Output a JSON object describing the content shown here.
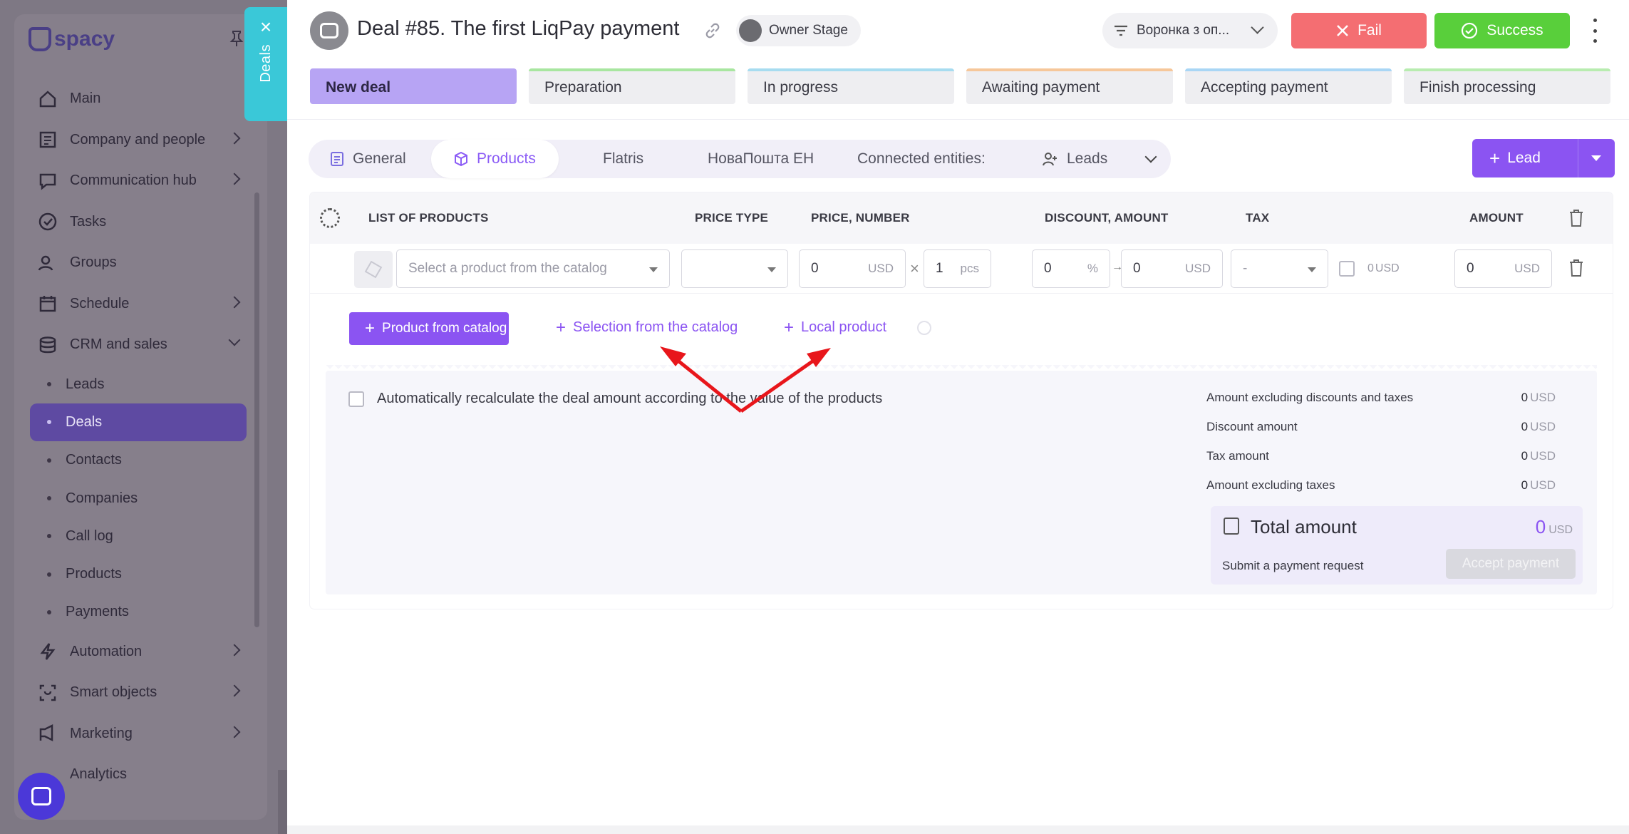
{
  "sidebar": {
    "logo": "spacy",
    "items": [
      {
        "label": "Main",
        "icon": "home-icon",
        "expand": false
      },
      {
        "label": "Company and people",
        "icon": "building-icon",
        "expand": true
      },
      {
        "label": "Communication hub",
        "icon": "chat-icon",
        "expand": true
      },
      {
        "label": "Tasks",
        "icon": "check-circle-icon",
        "expand": false
      },
      {
        "label": "Groups",
        "icon": "users-icon",
        "expand": false
      },
      {
        "label": "Schedule",
        "icon": "calendar-icon",
        "expand": true
      },
      {
        "label": "CRM and sales",
        "icon": "database-icon",
        "expand": true
      }
    ],
    "crm_sub": [
      "Leads",
      "Deals",
      "Contacts",
      "Companies",
      "Call log",
      "Products",
      "Payments"
    ],
    "items_after": [
      {
        "label": "Automation",
        "icon": "lightning-icon"
      },
      {
        "label": "Smart objects",
        "icon": "scan-icon"
      },
      {
        "label": "Marketing",
        "icon": "marketing-icon"
      },
      {
        "label": "Analytics",
        "icon": "analytics-icon"
      }
    ],
    "deals_tab": "Deals"
  },
  "header": {
    "title": "Deal #85. The first LiqPay payment",
    "stage_chip": "Owner Stage",
    "funnel": "Воронка з оп...",
    "fail_label": "Fail",
    "success_label": "Success",
    "stages": [
      {
        "label": "New deal",
        "color": "#b7a4f4"
      },
      {
        "label": "Preparation",
        "color": "#a8e6a0"
      },
      {
        "label": "In progress",
        "color": "#a7dcf0"
      },
      {
        "label": "Awaiting payment",
        "color": "#f6c79a"
      },
      {
        "label": "Accepting payment",
        "color": "#a9d6f5"
      },
      {
        "label": "Finish processing",
        "color": "#b8ecb0"
      }
    ]
  },
  "tabs": {
    "general": "General",
    "products": "Products",
    "flatris": "Flatris",
    "nova": "НоваПошта ЕН",
    "connected": "Connected entities:",
    "leads": "Leads",
    "lead_button": "Lead"
  },
  "table": {
    "columns": [
      "LIST OF PRODUCTS",
      "PRICE TYPE",
      "PRICE, NUMBER",
      "DISCOUNT, AMOUNT",
      "TAX",
      "AMOUNT"
    ],
    "row": {
      "product_placeholder": "Select a product from the catalog",
      "price": "0",
      "price_unit": "USD",
      "qty": "1",
      "qty_unit": "pcs",
      "discount_pct": "0",
      "discount_unit": "%",
      "discount_amount": "0",
      "discount_amount_unit": "USD",
      "tax": "-",
      "tax_amount": "0",
      "tax_unit": "USD",
      "amount": "0",
      "amount_unit": "USD"
    }
  },
  "actions": {
    "product_from_catalog": "Product from catalog",
    "selection_from_catalog": "Selection from the catalog",
    "local_product": "Local product"
  },
  "summary": {
    "recalc_label": "Automatically recalculate the deal amount according to the value of the products",
    "lines": [
      {
        "label": "Amount excluding discounts and taxes",
        "value": "0",
        "unit": "USD"
      },
      {
        "label": "Discount amount",
        "value": "0",
        "unit": "USD"
      },
      {
        "label": "Tax amount",
        "value": "0",
        "unit": "USD"
      },
      {
        "label": "Amount excluding taxes",
        "value": "0",
        "unit": "USD"
      }
    ],
    "total_label": "Total amount",
    "total_value": "0",
    "total_unit": "USD",
    "payment_request": "Submit a payment request",
    "accept_payment": "Accept payment"
  },
  "colors": {
    "accent": "#8b54f2",
    "fail": "#f46e72",
    "success": "#59cf3b",
    "annotation_arrow": "#e8161b"
  }
}
